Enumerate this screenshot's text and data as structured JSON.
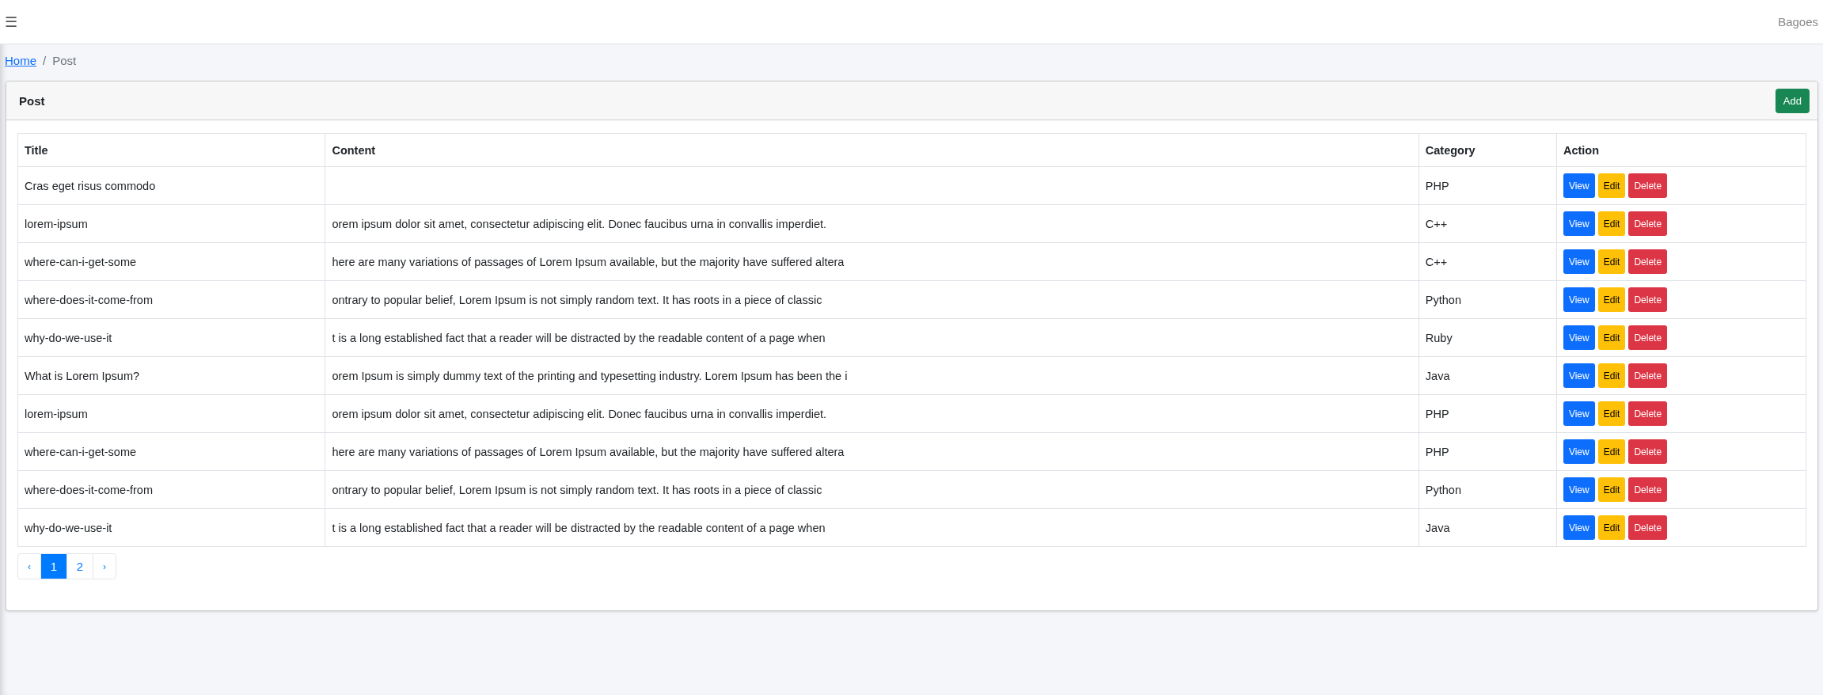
{
  "navbar": {
    "menu_icon": "☰",
    "user": "Bagoes"
  },
  "breadcrumb": {
    "separator": "/",
    "items": [
      {
        "label": "Home",
        "kind": "link"
      },
      {
        "label": "Post",
        "kind": "current"
      }
    ]
  },
  "card": {
    "title": "Post",
    "add_button": "Add"
  },
  "table": {
    "columns": [
      "Title",
      "Content",
      "Category",
      "Action"
    ],
    "rows": [
      {
        "title": "Cras eget risus commodo",
        "content": "",
        "category": "PHP",
        "actions": [
          {
            "kind": "view",
            "label": "View"
          },
          {
            "kind": "edit",
            "label": "Edit"
          },
          {
            "kind": "delete",
            "label": "Delete"
          }
        ]
      },
      {
        "title": "lorem-ipsum",
        "content": "orem ipsum dolor sit amet, consectetur adipiscing elit. Donec faucibus urna in convallis imperdiet.",
        "category": "C++",
        "actions": [
          {
            "kind": "view",
            "label": "View"
          },
          {
            "kind": "edit",
            "label": "Edit"
          },
          {
            "kind": "delete",
            "label": "Delete"
          }
        ]
      },
      {
        "title": "where-can-i-get-some",
        "content": "here are many variations of passages of Lorem Ipsum available, but the majority have suffered altera",
        "category": "C++",
        "actions": [
          {
            "kind": "view",
            "label": "View"
          },
          {
            "kind": "edit",
            "label": "Edit"
          },
          {
            "kind": "delete",
            "label": "Delete"
          }
        ]
      },
      {
        "title": "where-does-it-come-from",
        "content": "ontrary to popular belief, Lorem Ipsum is not simply random text. It has roots in a piece of classic",
        "category": "Python",
        "actions": [
          {
            "kind": "view",
            "label": "View"
          },
          {
            "kind": "edit",
            "label": "Edit"
          },
          {
            "kind": "delete",
            "label": "Delete"
          }
        ]
      },
      {
        "title": "why-do-we-use-it",
        "content": "t is a long established fact that a reader will be distracted by the readable content of a page when",
        "category": "Ruby",
        "actions": [
          {
            "kind": "view",
            "label": "View"
          },
          {
            "kind": "edit",
            "label": "Edit"
          },
          {
            "kind": "delete",
            "label": "Delete"
          }
        ]
      },
      {
        "title": "What is Lorem Ipsum?",
        "content": "orem Ipsum is simply dummy text of the printing and typesetting industry. Lorem Ipsum has been the i",
        "category": "Java",
        "actions": [
          {
            "kind": "view",
            "label": "View"
          },
          {
            "kind": "edit",
            "label": "Edit"
          },
          {
            "kind": "delete",
            "label": "Delete"
          }
        ]
      },
      {
        "title": "lorem-ipsum",
        "content": "orem ipsum dolor sit amet, consectetur adipiscing elit. Donec faucibus urna in convallis imperdiet.",
        "category": "PHP",
        "actions": [
          {
            "kind": "view",
            "label": "View"
          },
          {
            "kind": "edit",
            "label": "Edit"
          },
          {
            "kind": "delete",
            "label": "Delete"
          }
        ]
      },
      {
        "title": "where-can-i-get-some",
        "content": "here are many variations of passages of Lorem Ipsum available, but the majority have suffered altera",
        "category": "PHP",
        "actions": [
          {
            "kind": "view",
            "label": "View"
          },
          {
            "kind": "edit",
            "label": "Edit"
          },
          {
            "kind": "delete",
            "label": "Delete"
          }
        ]
      },
      {
        "title": "where-does-it-come-from",
        "content": "ontrary to popular belief, Lorem Ipsum is not simply random text. It has roots in a piece of classic",
        "category": "Python",
        "actions": [
          {
            "kind": "view",
            "label": "View"
          },
          {
            "kind": "edit",
            "label": "Edit"
          },
          {
            "kind": "delete",
            "label": "Delete"
          }
        ]
      },
      {
        "title": "why-do-we-use-it",
        "content": "t is a long established fact that a reader will be distracted by the readable content of a page when",
        "category": "Java",
        "actions": [
          {
            "kind": "view",
            "label": "View"
          },
          {
            "kind": "edit",
            "label": "Edit"
          },
          {
            "kind": "delete",
            "label": "Delete"
          }
        ]
      }
    ]
  },
  "pagination": [
    {
      "label": "‹",
      "kind": "prev",
      "selected": false
    },
    {
      "label": "1",
      "kind": "page",
      "selected": true
    },
    {
      "label": "2",
      "kind": "page",
      "selected": false
    },
    {
      "label": "›",
      "kind": "next",
      "selected": false
    }
  ]
}
